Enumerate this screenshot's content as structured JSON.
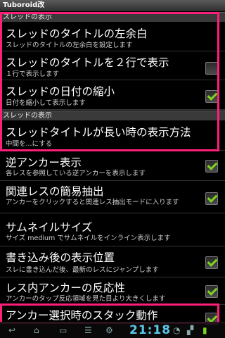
{
  "app": {
    "title": "Tuboroid改"
  },
  "sections": [
    {
      "label": "スレッドの表示"
    },
    {
      "label": "スレッドの表示"
    }
  ],
  "items": [
    {
      "title": "スレッドのタイトルの左余白",
      "summary": "スレッドのタイトルの左余白を設定します",
      "checkbox": "none"
    },
    {
      "title": "スレッドのタイトルを２行で表示",
      "summary": "１行で表示します",
      "checkbox": "unchecked"
    },
    {
      "title": "スレッドの日付の縮小",
      "summary": "日付を縮小して表示します",
      "checkbox": "checked"
    },
    {
      "title": "スレッドタイトルが長い時の表示方法",
      "summary": "中間を...にする",
      "checkbox": "none"
    },
    {
      "title": "逆アンカー表示",
      "summary": "各レスを参照している逆アンカーを表示します",
      "checkbox": "checked"
    },
    {
      "title": "関連レスの簡易抽出",
      "summary": "アンカーをクリックすると関連レス抽出モードに入ります",
      "checkbox": "checked"
    },
    {
      "title": "サムネイルサイズ",
      "summary": "サイズ medium でサムネイルをインライン表示します",
      "checkbox": "none"
    },
    {
      "title": "書き込み後の表示位置",
      "summary": "スレに書き込んだ後、最新のレスにジャンプします",
      "checkbox": "checked"
    },
    {
      "title": "レス内アンカーの反応性",
      "summary": "アンカーのタップ反応領域を見た目より大きくします",
      "checkbox": "checked"
    },
    {
      "title": "アンカー選択時のスタック動作",
      "summary": "",
      "checkbox": "checked"
    }
  ],
  "statusbar": {
    "time": "21:18"
  },
  "colors": {
    "highlight": "#ff1f7a",
    "check": "#7ed321",
    "clock": "#5bc8e8"
  }
}
